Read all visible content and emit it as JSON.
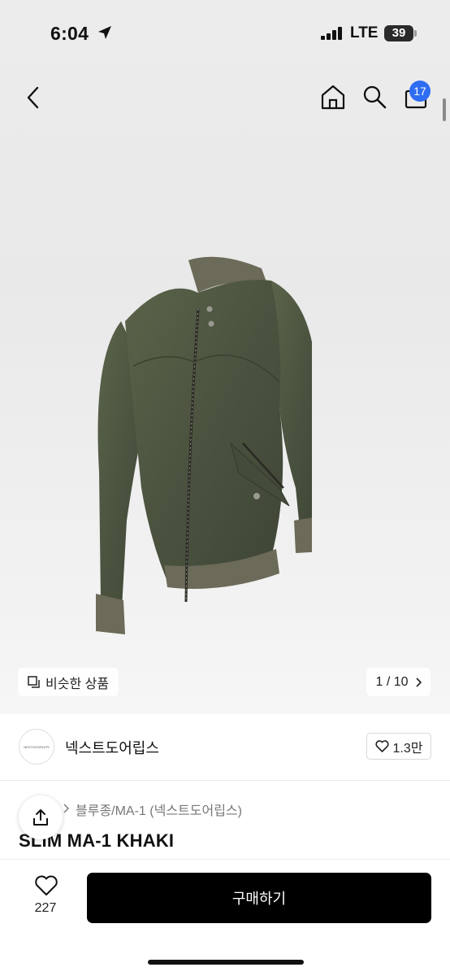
{
  "status_bar": {
    "time": "6:04",
    "network": "LTE",
    "battery": "39"
  },
  "nav": {
    "cart_count": "17"
  },
  "gallery": {
    "similar_label": "비슷한 상품",
    "pager": "1 / 10"
  },
  "shop": {
    "logo_text": "NEXTDOORLIPS",
    "name": "넥스트도어립스",
    "likes": "1.3만"
  },
  "product": {
    "breadcrumb_fragment": "블루종/MA-1 (넥스트도어립스)",
    "title": "SLIM MA-1 KHAKI"
  },
  "bottom_bar": {
    "wish_count": "227",
    "buy_label": "구매하기"
  },
  "colors": {
    "accent_badge": "#2e6cf2",
    "buy_button": "#000000",
    "jacket": "#4d5540"
  }
}
